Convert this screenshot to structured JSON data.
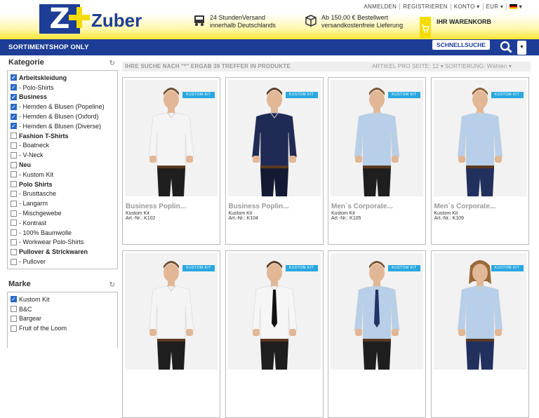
{
  "brand": {
    "logo_text": "Zuber"
  },
  "topnav": {
    "login": "ANMELDEN",
    "register": "REGISTRIEREN",
    "account": "KONTO ▾",
    "currency": "EUR ▾",
    "lang": "▾"
  },
  "info": {
    "shipping_1": "24 StundenVersand",
    "shipping_2": "innerhalb Deutschlands",
    "free_1": "Ab 150,00 € Bestellwert",
    "free_2": "versandkostenfreie Lieferung"
  },
  "cart": {
    "label": "IHR WARENKORB"
  },
  "nav": {
    "assortment": "SORTIMENT",
    "shop_only": "SHOP ONLY",
    "quick_search": "SCHNELLSUCHE"
  },
  "results": {
    "summary": "IHRE SUCHE NACH \"*\" ERGAB 39 TREFFER IN PRODUKTE",
    "per_page": "ARTIKEL PRO SEITE:  12",
    "sort": "SORTIERUNG:  Wählen"
  },
  "category": {
    "title": "Kategorie",
    "items": [
      {
        "label": "Arbeitskleidung",
        "checked": true,
        "bold": true
      },
      {
        "label": "- Polo-Shirts",
        "checked": true,
        "bold": false
      },
      {
        "label": "Business",
        "checked": true,
        "bold": true
      },
      {
        "label": "- Hemden & Blusen (Popeline)",
        "checked": true,
        "bold": false
      },
      {
        "label": "- Hemden & Blusen (Oxford)",
        "checked": true,
        "bold": false
      },
      {
        "label": "- Hemden & Blusen (Diverse)",
        "checked": true,
        "bold": false
      },
      {
        "label": "Fashion T-Shirts",
        "checked": false,
        "bold": true
      },
      {
        "label": "- Boatneck",
        "checked": false,
        "bold": false
      },
      {
        "label": "- V-Neck",
        "checked": false,
        "bold": false
      },
      {
        "label": "Neu",
        "checked": false,
        "bold": true
      },
      {
        "label": "- Kustom Kit",
        "checked": false,
        "bold": false
      },
      {
        "label": "Polo Shirts",
        "checked": false,
        "bold": true
      },
      {
        "label": "- Brusttasche",
        "checked": false,
        "bold": false
      },
      {
        "label": "- Langarm",
        "checked": false,
        "bold": false
      },
      {
        "label": "- Mischgewebe",
        "checked": false,
        "bold": false
      },
      {
        "label": "- Kontrast",
        "checked": false,
        "bold": false
      },
      {
        "label": "- 100% Baumwolle",
        "checked": false,
        "bold": false
      },
      {
        "label": "- Workwear Polo-Shirts",
        "checked": false,
        "bold": false
      },
      {
        "label": "Pullover & Strickwaren",
        "checked": false,
        "bold": true
      },
      {
        "label": "- Pullover",
        "checked": false,
        "bold": false
      }
    ]
  },
  "marke": {
    "title": "Marke",
    "items": [
      {
        "label": "Kustom Kit",
        "checked": true,
        "bold": false
      },
      {
        "label": "B&C",
        "checked": false,
        "bold": false
      },
      {
        "label": "Bargear",
        "checked": false,
        "bold": false
      },
      {
        "label": "Fruit of the Loom",
        "checked": false,
        "bold": false
      }
    ]
  },
  "products": [
    {
      "name": "Business Poplin...",
      "brand": "Kustom Kit",
      "art": "Art.-Nr.: K102",
      "badge": "KUSTOM KIT",
      "shirt": "#f4f4f4",
      "pants": "#1e1e1e",
      "tie": "",
      "hair": "#6b4a2a",
      "female": false
    },
    {
      "name": "Business Poplin...",
      "brand": "Kustom Kit",
      "art": "Art.-Nr.: K104",
      "badge": "KUSTOM KIT",
      "shirt": "#1f2a55",
      "pants": "#141a33",
      "tie": "",
      "hair": "#5a3a20",
      "female": false
    },
    {
      "name": "Men´s Corporate...",
      "brand": "Kustom Kit",
      "art": "Art.-Nr.: K105",
      "badge": "KUSTOM KIT",
      "shirt": "#b7cfe8",
      "pants": "#1e1e1e",
      "tie": "",
      "hair": "#7a5230",
      "female": false
    },
    {
      "name": "Men´s Corporate...",
      "brand": "Kustom Kit",
      "art": "Art.-Nr.: K109",
      "badge": "KUSTOM KIT",
      "shirt": "#b7cfe8",
      "pants": "#22305e",
      "tie": "",
      "hair": "#8a5a30",
      "female": false
    },
    {
      "name": "",
      "brand": "",
      "art": "",
      "badge": "KUSTOM KIT",
      "shirt": "#f4f4f4",
      "pants": "#1e1e1e",
      "tie": "",
      "hair": "#6b4a2a",
      "female": false
    },
    {
      "name": "",
      "brand": "",
      "art": "",
      "badge": "KUSTOM KIT",
      "shirt": "#f6f6f6",
      "pants": "#1e1e1e",
      "tie": "#111111",
      "hair": "#5a3a20",
      "female": false
    },
    {
      "name": "",
      "brand": "",
      "art": "",
      "badge": "KUSTOM KIT",
      "shirt": "#b7cfe8",
      "pants": "#1e1e1e",
      "tie": "#223366",
      "hair": "#7a5230",
      "female": false
    },
    {
      "name": "",
      "brand": "",
      "art": "",
      "badge": "KUSTOM KIT",
      "shirt": "#b7cfe8",
      "pants": "#22305e",
      "tie": "",
      "hair": "#9a6a3a",
      "female": true
    }
  ]
}
